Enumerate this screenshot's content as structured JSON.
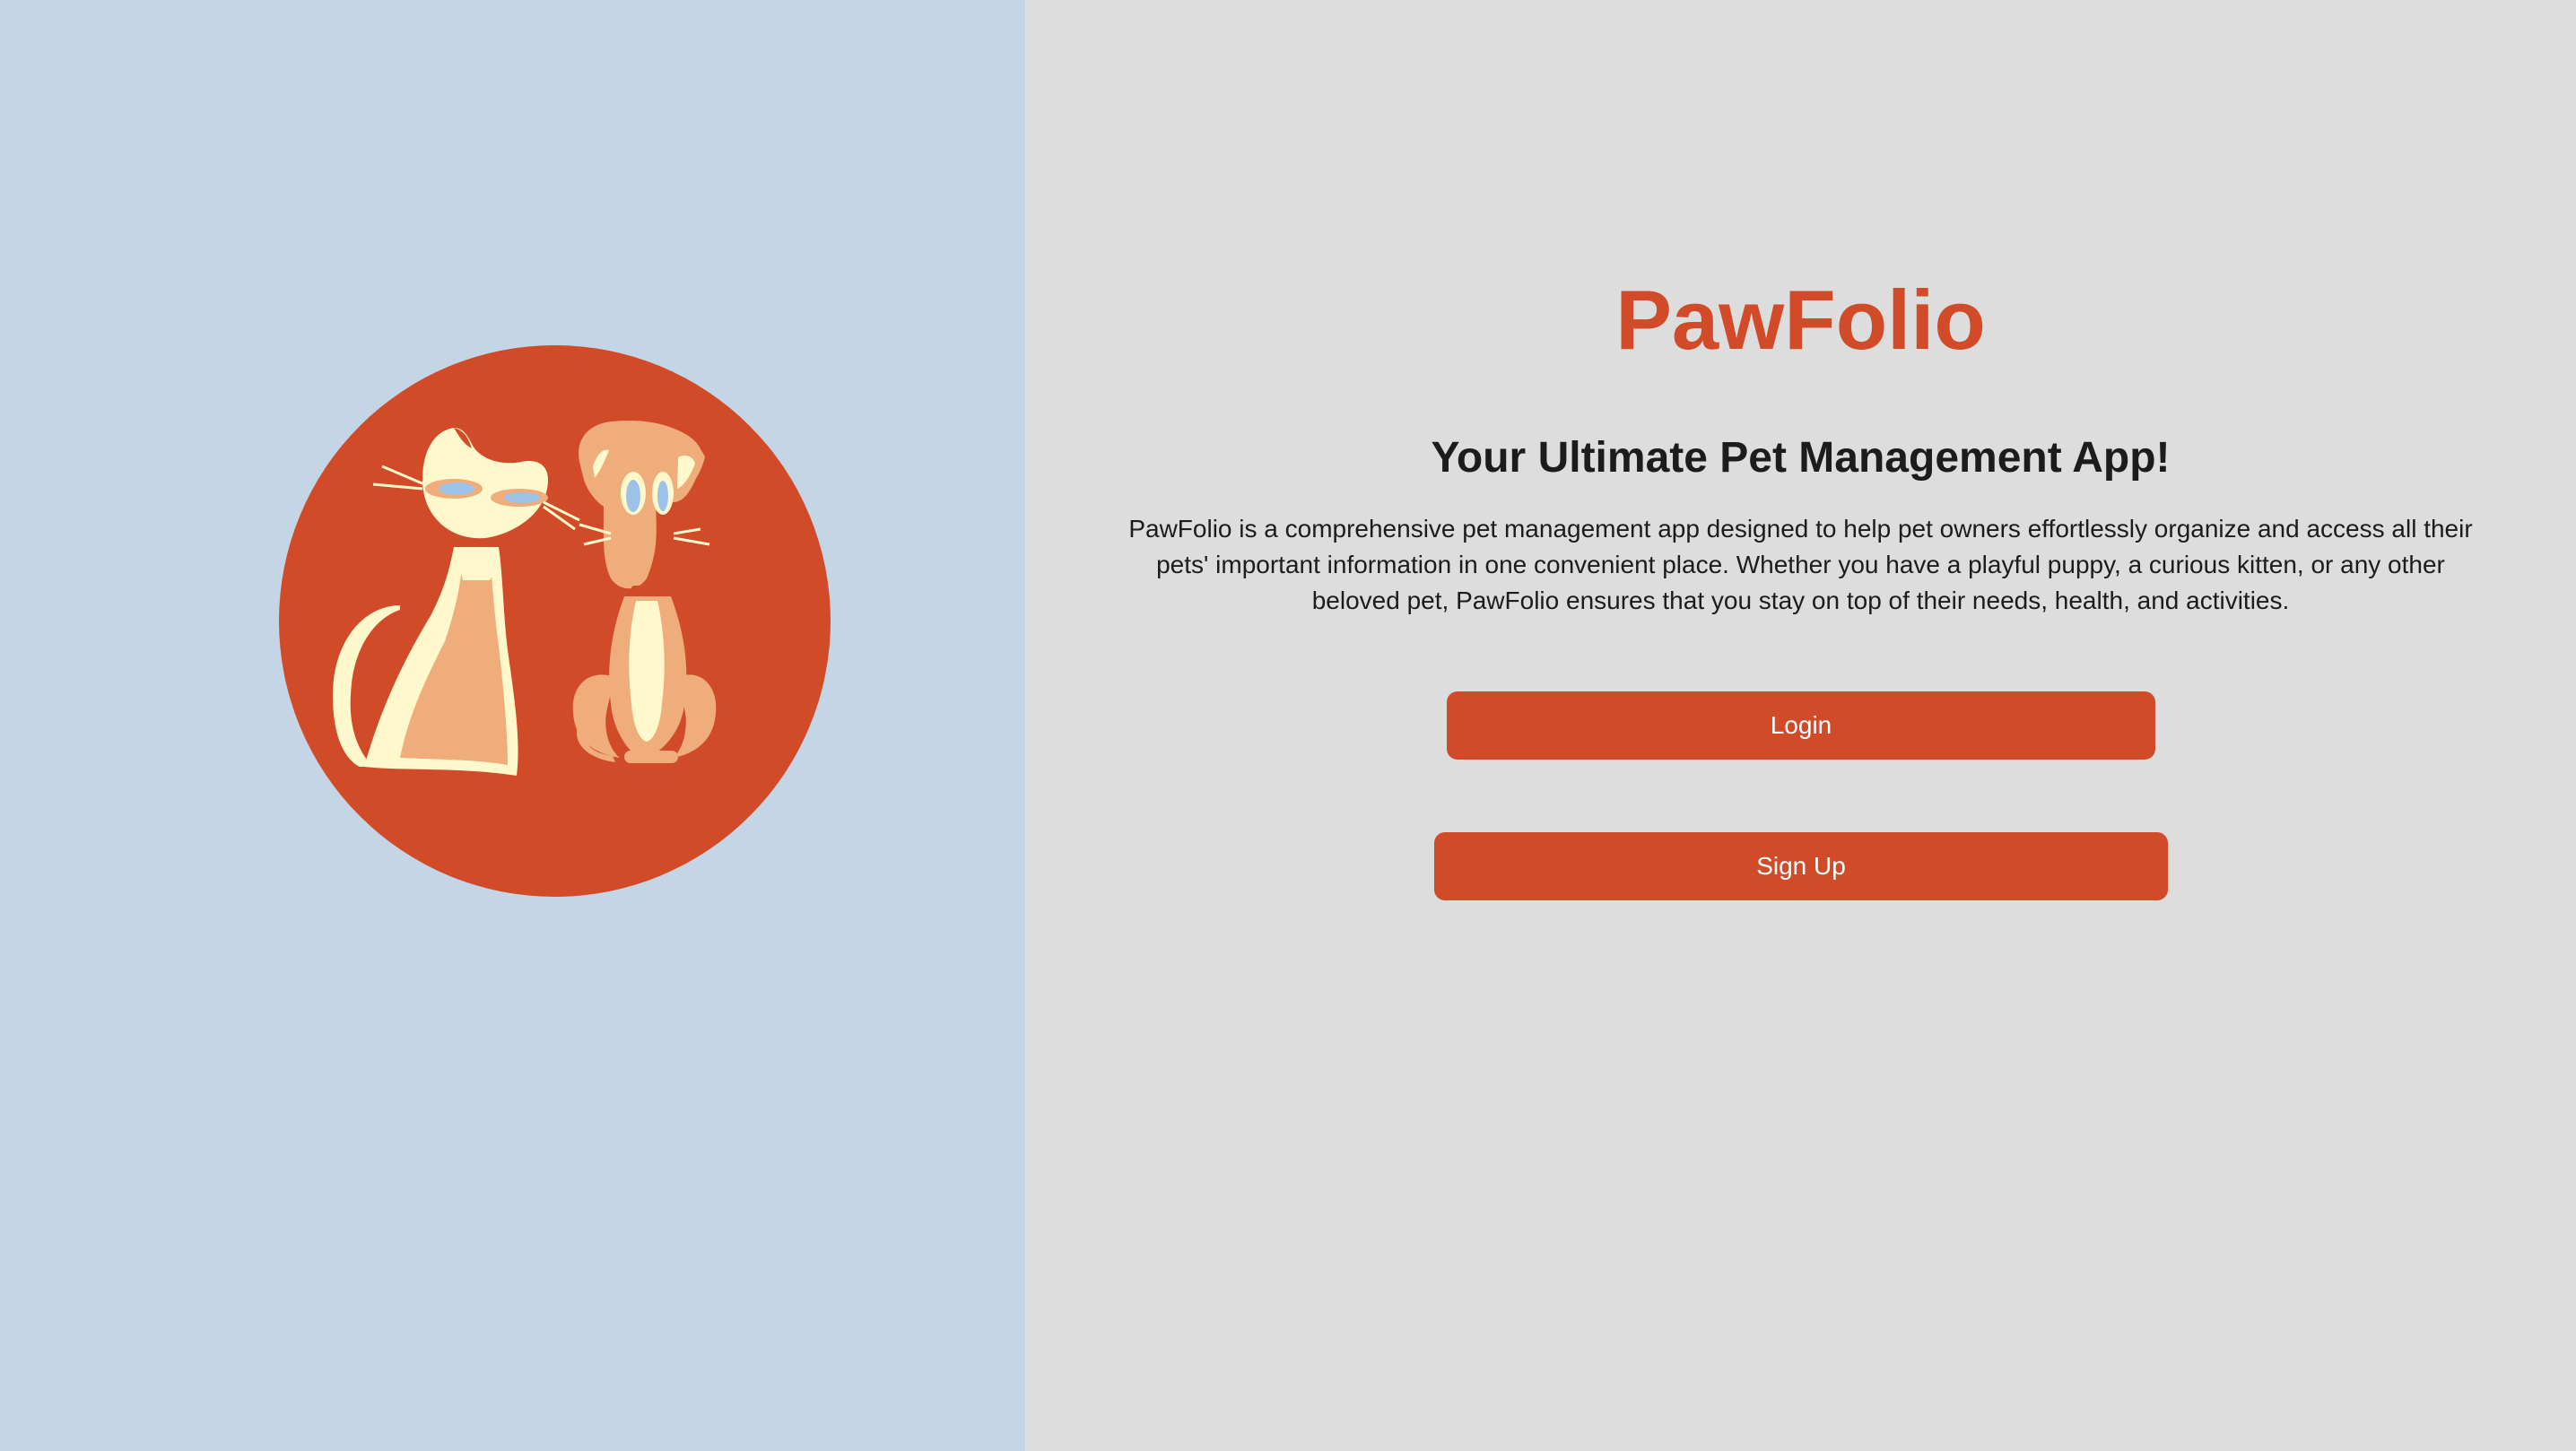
{
  "app": {
    "title": "PawFolio",
    "subtitle": "Your Ultimate Pet Management App!",
    "description": "PawFolio is a comprehensive pet management app designed to help pet owners effortlessly organize and access all their pets' important information in one convenient place. Whether you have a playful puppy, a curious kitten, or any other beloved pet, PawFolio ensures that you stay on top of their needs, health, and activities."
  },
  "actions": {
    "login_label": "Login",
    "signup_label": "Sign Up"
  },
  "logo": {
    "icon": "cat-and-dog-logo"
  },
  "colors": {
    "accent": "#d24b28",
    "left_background": "#c4d6e6",
    "right_background": "#dddddd",
    "cream": "#fff8cc",
    "peach": "#efad7c",
    "eye_blue": "#9dc2e8"
  }
}
